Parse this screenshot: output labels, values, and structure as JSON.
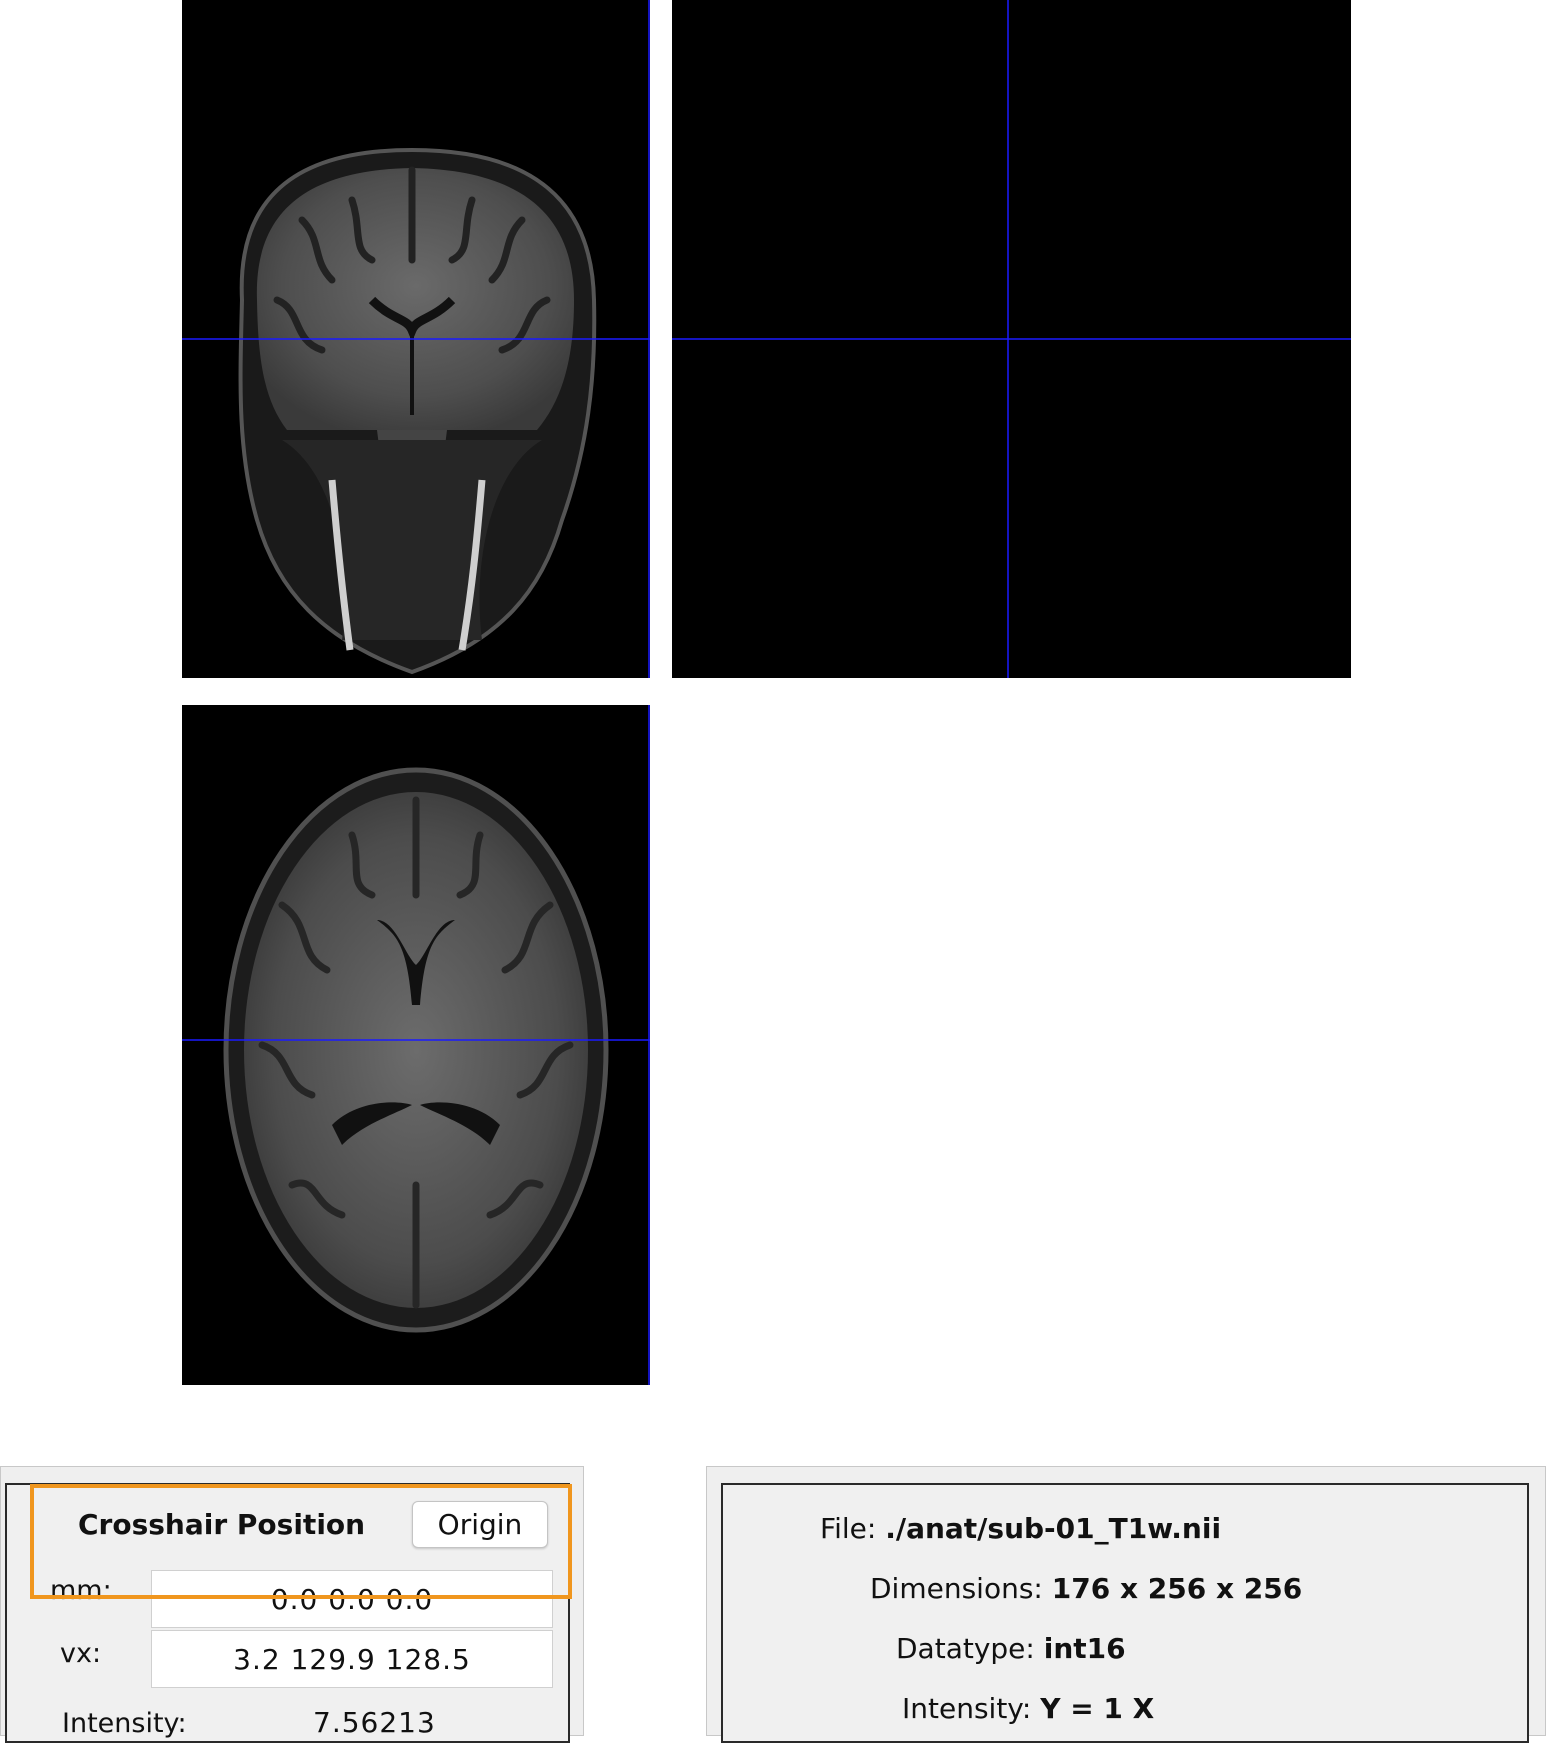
{
  "views": {
    "coronal": "coronal-slice-view",
    "sagittal": "sagittal-slice-view",
    "axial": "axial-slice-view",
    "crosshair_color": "#1a1aff"
  },
  "crosshair": {
    "title": "Crosshair Position",
    "origin_button": "Origin",
    "mm_label": "mm:",
    "mm_value": "0.0 0.0 0.0",
    "vx_label": "vx:",
    "vx_value": "3.2 129.9 128.5",
    "intensity_label": "Intensity:",
    "intensity_value": "7.56213",
    "highlight_color": "#f0961e"
  },
  "file_info": {
    "file_label": "File:",
    "file_value": "./anat/sub-01_T1w.nii",
    "dimensions_label": "Dimensions:",
    "dimensions_value": "176 x 256 x 256",
    "datatype_label": "Datatype:",
    "datatype_value": "int16",
    "intensity_label": "Intensity:",
    "intensity_value": "Y = 1 X"
  }
}
